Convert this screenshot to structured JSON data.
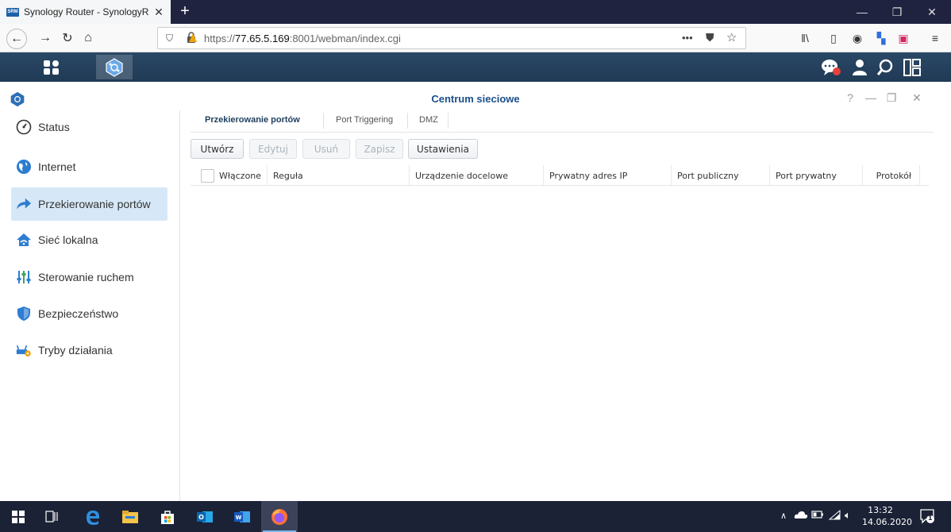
{
  "browser": {
    "tab_title": "Synology Router - SynologyRouter",
    "favicon_text": "SRM",
    "url_prefix": "https://",
    "url_host": "77.65.5.169",
    "url_rest": ":8001/webman/index.cgi",
    "more_label": "•••"
  },
  "window": {
    "title": "Centrum sieciowe",
    "help_label": "?"
  },
  "sidebar": {
    "items": [
      {
        "label": "Status",
        "icon": "gauge-icon"
      },
      {
        "label": "Internet",
        "icon": "globe-icon"
      },
      {
        "label": "Przekierowanie portów",
        "icon": "arrow-forward-icon"
      },
      {
        "label": "Sieć lokalna",
        "icon": "home-icon"
      },
      {
        "label": "Sterowanie ruchem",
        "icon": "sliders-icon"
      },
      {
        "label": "Bezpieczeństwo",
        "icon": "shield-icon"
      },
      {
        "label": "Tryby działania",
        "icon": "router-mode-icon"
      }
    ],
    "active_index": 2
  },
  "tabs": [
    {
      "label": "Przekierowanie portów",
      "active": true
    },
    {
      "label": "Port Triggering",
      "active": false
    },
    {
      "label": "DMZ",
      "active": false
    }
  ],
  "toolbar": {
    "create": "Utwórz",
    "edit": "Edytuj",
    "delete": "Usuń",
    "save": "Zapisz",
    "settings": "Ustawienia"
  },
  "grid": {
    "columns": [
      "Włączone",
      "Reguła",
      "Urządzenie docelowe",
      "Prywatny adres IP",
      "Port publiczny",
      "Port prywatny",
      "Protokół"
    ],
    "rows": []
  },
  "taskbar": {
    "time": "13:32",
    "date": "14.06.2020",
    "notification_count": "1"
  }
}
